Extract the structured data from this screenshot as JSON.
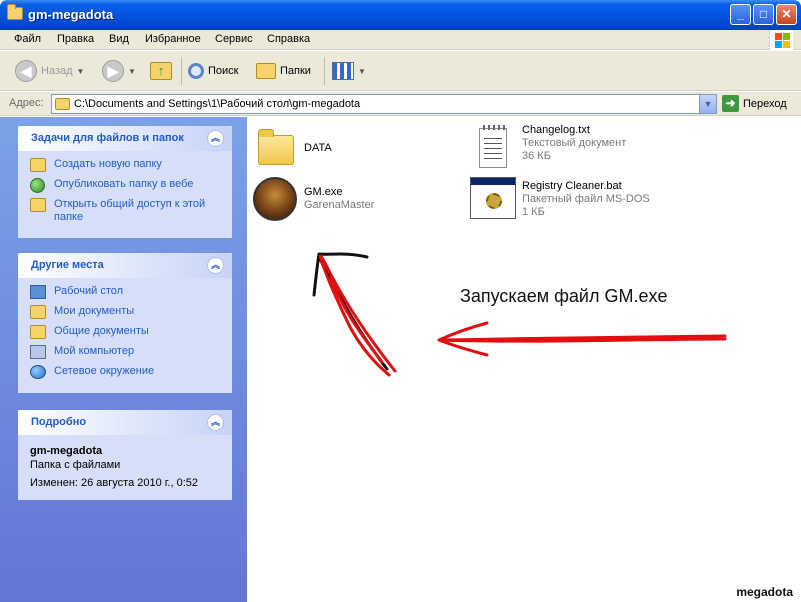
{
  "window": {
    "title": "gm-megadota"
  },
  "menu": [
    "Файл",
    "Правка",
    "Вид",
    "Избранное",
    "Сервис",
    "Справка"
  ],
  "toolbar": {
    "back_label": "Назад",
    "search_label": "Поиск",
    "folders_label": "Папки"
  },
  "address": {
    "label": "Адрес:",
    "value": "C:\\Documents and Settings\\1\\Рабочий стол\\gm-megadota",
    "go_label": "Переход"
  },
  "sidebar": {
    "tasks": {
      "title": "Задачи для файлов и папок",
      "items": [
        "Создать новую папку",
        "Опубликовать папку в вебе",
        "Открыть общий доступ к этой папке"
      ]
    },
    "places": {
      "title": "Другие места",
      "items": [
        "Рабочий стол",
        "Мои документы",
        "Общие документы",
        "Мой компьютер",
        "Сетевое окружение"
      ]
    },
    "details": {
      "title": "Подробно",
      "name": "gm-megadota",
      "type": "Папка с файлами",
      "modified": "Изменен: 26 августа 2010 г., 0:52"
    }
  },
  "files": [
    {
      "name": "DATA",
      "sub1": "",
      "sub2": "",
      "icon": "folder-icon"
    },
    {
      "name": "Changelog.txt",
      "sub1": "Текстовый документ",
      "sub2": "36 КБ",
      "icon": "text-file-icon"
    },
    {
      "name": "GM.exe",
      "sub1": "GarenaMaster",
      "sub2": "",
      "icon": "garena-master-icon"
    },
    {
      "name": "Registry Cleaner.bat",
      "sub1": "Пакетный файл MS-DOS",
      "sub2": "1 КБ",
      "icon": "batch-file-icon"
    }
  ],
  "annotation": "Запускаем файл GM.exe",
  "watermark": "megadota",
  "colors": {
    "titlebar": "#0054e3",
    "sidebar": "#7ba2e7",
    "task_link": "#215dc6",
    "arrow_red": "#e01010"
  }
}
